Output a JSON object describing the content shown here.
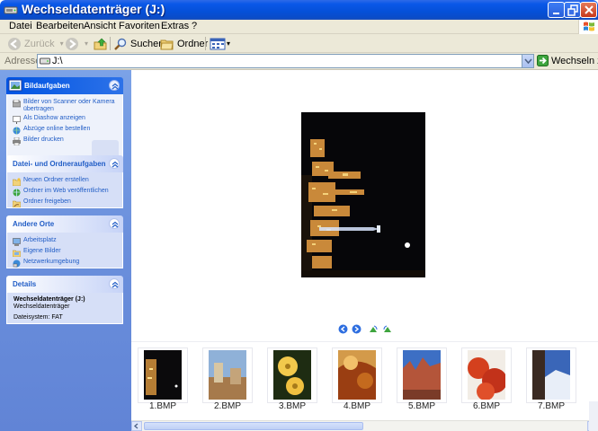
{
  "window": {
    "title": "Wechseldatenträger (J:)"
  },
  "menu": [
    {
      "label": "Datei",
      "ul": "D"
    },
    {
      "label": "Bearbeiten",
      "ul": "B"
    },
    {
      "label": "Ansicht",
      "ul": "A"
    },
    {
      "label": "Favoriten",
      "ul": "F"
    },
    {
      "label": "Extras",
      "ul": "E"
    },
    {
      "label": "?",
      "ul": "?"
    }
  ],
  "toolbar": {
    "back_label": "Zurück",
    "search_label": "Suchen",
    "folders_label": "Ordner"
  },
  "address": {
    "label": "Adresse",
    "value": "J:\\",
    "go_label": "Wechseln zu"
  },
  "taskpane": {
    "picture_tasks": {
      "title": "Bildaufgaben",
      "items": [
        "Bilder von Scanner oder Kamera übertragen",
        "Als Diashow anzeigen",
        "Abzüge online bestellen",
        "Bilder drucken"
      ]
    },
    "file_tasks": {
      "title": "Datei- und Ordneraufgaben",
      "items": [
        "Neuen Ordner erstellen",
        "Ordner im Web veröffentlichen",
        "Ordner freigeben"
      ]
    },
    "other_places": {
      "title": "Andere Orte",
      "items": [
        "Arbeitsplatz",
        "Eigene Bilder",
        "Netzwerkumgebung"
      ]
    },
    "details": {
      "title": "Details",
      "name": "Wechseldatenträger (J:)",
      "type": "Wechseldatenträger",
      "filesystem": "Dateisystem: FAT"
    }
  },
  "filmstrip": {
    "thumbnails": [
      {
        "label": "1.BMP",
        "color": "#1b1410"
      },
      {
        "label": "2.BMP",
        "color": "#5a7aa0"
      },
      {
        "label": "3.BMP",
        "color": "#1c2a12"
      },
      {
        "label": "4.BMP",
        "color": "#8a4a1a"
      },
      {
        "label": "5.BMP",
        "color": "#9a4428"
      },
      {
        "label": "6.BMP",
        "color": "#c0381a"
      },
      {
        "label": "7.BMP",
        "color": "#3a66b8"
      }
    ]
  },
  "colors": {
    "titlebar": "#0a58e8",
    "taskpane": "#6a8fdc",
    "link": "#215dc6"
  }
}
